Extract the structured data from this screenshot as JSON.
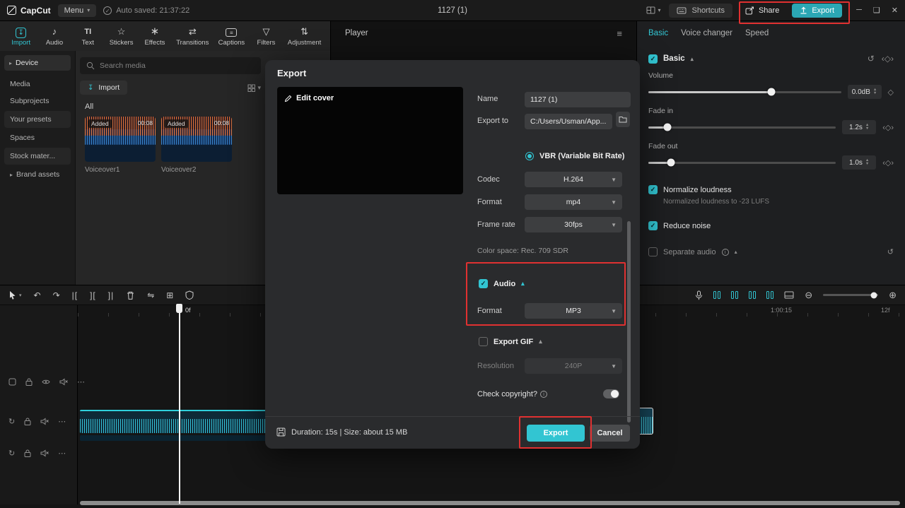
{
  "colors": {
    "accent": "#32c5d2",
    "annotation": "#e03131"
  },
  "titlebar": {
    "logo": "CapCut",
    "menu_label": "Menu",
    "autosave": "Auto saved: 21:37:22",
    "project_title": "1127 (1)",
    "shortcuts_label": "Shortcuts",
    "share_label": "Share",
    "export_label": "Export"
  },
  "ribbon": {
    "items": [
      {
        "label": "Import"
      },
      {
        "label": "Audio"
      },
      {
        "label": "Text"
      },
      {
        "label": "Stickers"
      },
      {
        "label": "Effects"
      },
      {
        "label": "Transitions"
      },
      {
        "label": "Captions"
      },
      {
        "label": "Filters"
      },
      {
        "label": "Adjustment"
      }
    ]
  },
  "sidebar": {
    "device_label": "Device",
    "items": [
      {
        "label": "Media"
      },
      {
        "label": "Subprojects"
      },
      {
        "label": "Your presets"
      },
      {
        "label": "Spaces"
      },
      {
        "label": "Stock mater..."
      },
      {
        "label": "Brand assets"
      }
    ]
  },
  "media": {
    "search_placeholder": "Search media",
    "import_label": "Import",
    "all_label": "All",
    "clips": [
      {
        "name": "Voiceover1",
        "badge": "Added",
        "duration": "00:08"
      },
      {
        "name": "Voiceover2",
        "badge": "Added",
        "duration": "00:08"
      }
    ]
  },
  "player": {
    "title": "Player"
  },
  "inspector": {
    "tabs": [
      {
        "label": "Basic"
      },
      {
        "label": "Voice changer"
      },
      {
        "label": "Speed"
      }
    ],
    "section_title": "Basic",
    "volume_label": "Volume",
    "volume_value": "0.0dB",
    "fade_in_label": "Fade in",
    "fade_in_value": "1.2s",
    "fade_out_label": "Fade out",
    "fade_out_value": "1.0s",
    "normalize_label": "Normalize loudness",
    "normalize_sub": "Normalized loudness to -23 LUFS",
    "reduce_noise_label": "Reduce noise",
    "separate_audio_label": "Separate audio"
  },
  "export_dialog": {
    "title": "Export",
    "edit_cover_label": "Edit cover",
    "name_label": "Name",
    "name_value": "1127 (1)",
    "export_to_label": "Export to",
    "export_to_value": "C:/Users/Usman/App...",
    "vbr_label": "VBR (Variable Bit Rate)",
    "codec_label": "Codec",
    "codec_value": "H.264",
    "format_label": "Format",
    "format_value": "mp4",
    "frame_rate_label": "Frame rate",
    "frame_rate_value": "30fps",
    "color_space": "Color space: Rec. 709 SDR",
    "audio_label": "Audio",
    "audio_format_label": "Format",
    "audio_format_value": "MP3",
    "export_gif_label": "Export GIF",
    "resolution_label": "Resolution",
    "resolution_value": "240P",
    "copyright_label": "Check copyright?",
    "footer_info": "Duration: 15s | Size: about 15 MB",
    "export_button": "Export",
    "cancel_button": "Cancel"
  },
  "timeline": {
    "ruler_zero": "0f",
    "ruler_mid": "1:00:15",
    "ruler_end": "12f"
  }
}
